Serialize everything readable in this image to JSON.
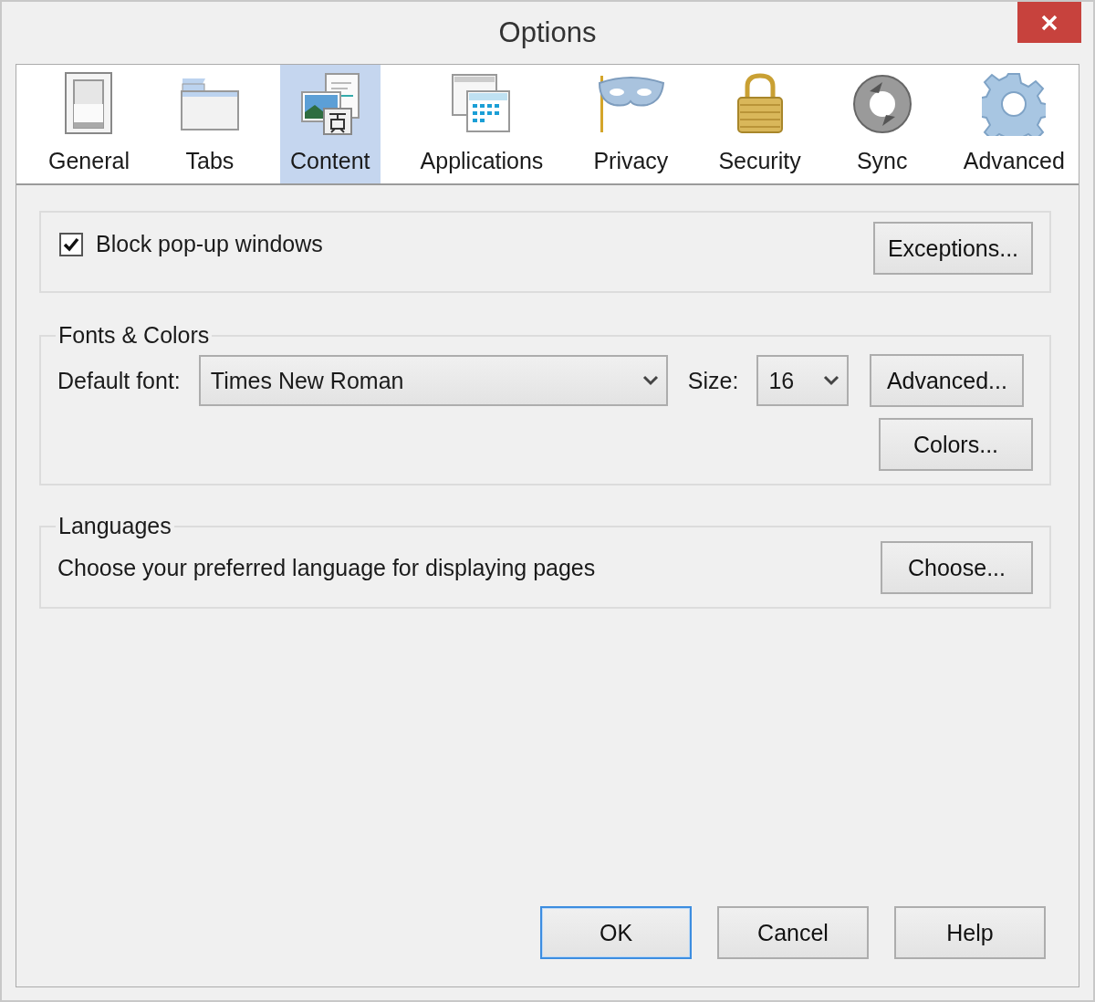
{
  "window": {
    "title": "Options"
  },
  "tabs": [
    {
      "label": "General",
      "kind": "general",
      "selected": false
    },
    {
      "label": "Tabs",
      "kind": "tabs",
      "selected": false
    },
    {
      "label": "Content",
      "kind": "content",
      "selected": true
    },
    {
      "label": "Applications",
      "kind": "applications",
      "selected": false
    },
    {
      "label": "Privacy",
      "kind": "privacy",
      "selected": false
    },
    {
      "label": "Security",
      "kind": "security",
      "selected": false
    },
    {
      "label": "Sync",
      "kind": "sync",
      "selected": false
    },
    {
      "label": "Advanced",
      "kind": "advanced",
      "selected": false
    }
  ],
  "popups": {
    "block_popups": {
      "label": "Block pop-up windows",
      "checked": true
    },
    "exceptions_button": "Exceptions..."
  },
  "fonts_colors": {
    "title": "Fonts & Colors",
    "default_font_label": "Default font:",
    "default_font": "Times New Roman",
    "size_label": "Size:",
    "size": "16",
    "advanced_button": "Advanced...",
    "colors_button": "Colors..."
  },
  "languages": {
    "title": "Languages",
    "description": "Choose your preferred language for displaying pages",
    "choose_button": "Choose..."
  },
  "buttons": [
    {
      "label": "OK",
      "default": true
    },
    {
      "label": "Cancel",
      "default": false
    },
    {
      "label": "Help",
      "default": false
    }
  ]
}
